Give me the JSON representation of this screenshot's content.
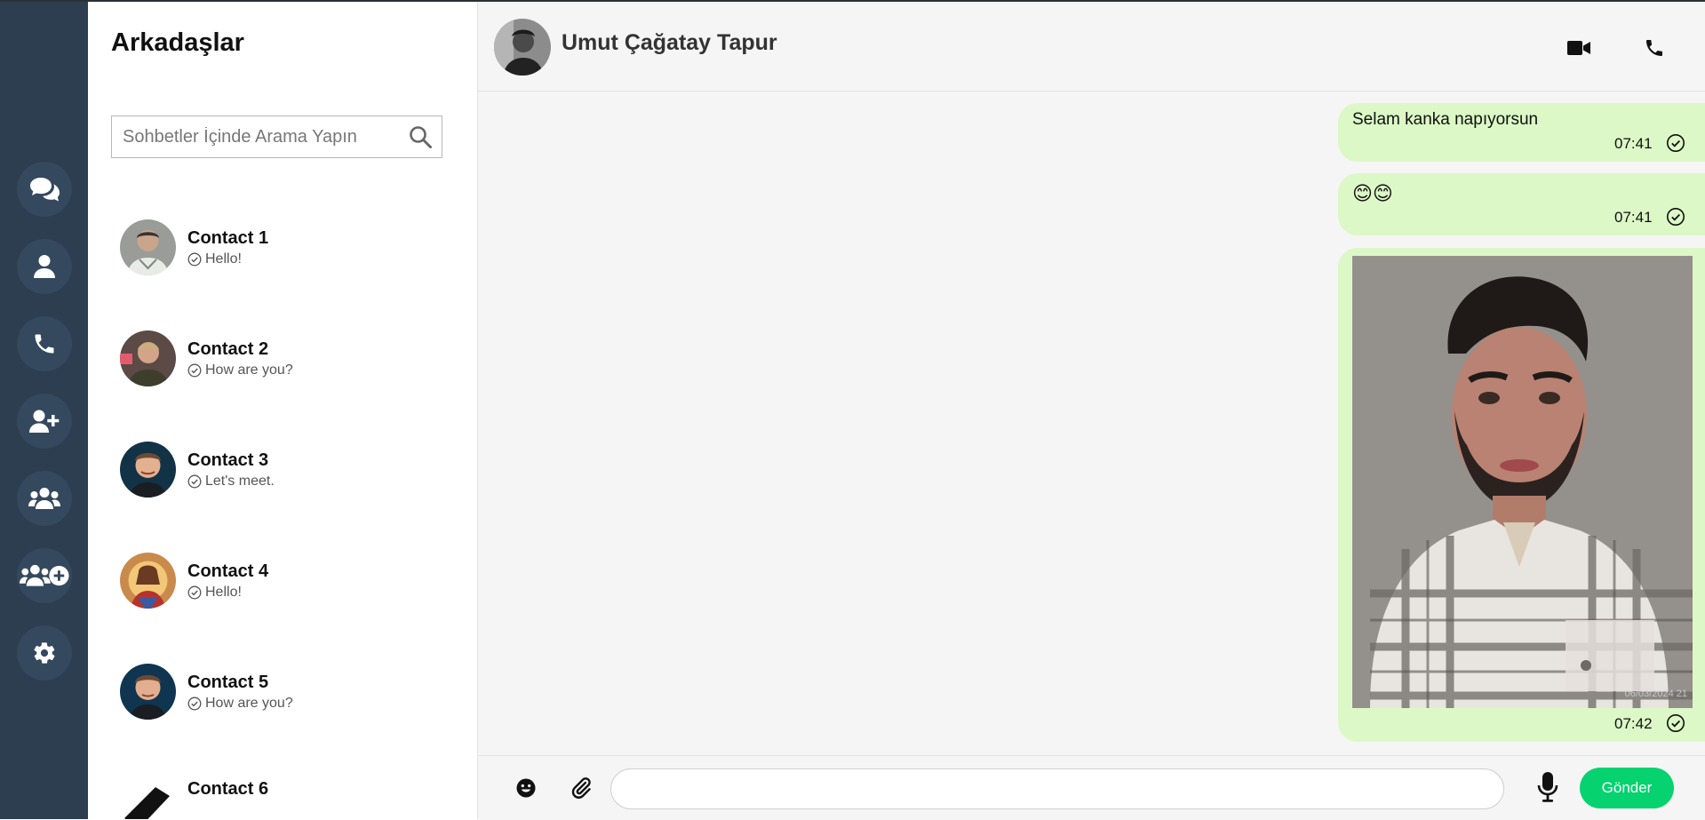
{
  "nav": {
    "icons": [
      "chats-icon",
      "profile-icon",
      "calls-icon",
      "add-friend-icon",
      "groups-icon",
      "add-group-icon",
      "settings-icon"
    ]
  },
  "sidebar": {
    "title": "Arkadaşlar",
    "search_placeholder": "Sohbetler İçinde Arama Yapın",
    "contacts": [
      {
        "name": "Contact 1",
        "last_message": "Hello!"
      },
      {
        "name": "Contact 2",
        "last_message": "How are you?"
      },
      {
        "name": "Contact 3",
        "last_message": "Let's meet."
      },
      {
        "name": "Contact 4",
        "last_message": "Hello!"
      },
      {
        "name": "Contact 5",
        "last_message": "How are you?"
      },
      {
        "name": "Contact 6",
        "last_message": ""
      }
    ]
  },
  "chat": {
    "contact_name": "Umut Çağatay Tapur",
    "header_icons": [
      "video-call-icon",
      "phone-icon"
    ],
    "messages": [
      {
        "type": "text",
        "text": "Selam kanka napıyorsun",
        "time": "07:41",
        "status": "sent"
      },
      {
        "type": "emoji",
        "text": "😊😊",
        "time": "07:41",
        "status": "sent"
      },
      {
        "type": "image",
        "image_caption": "06/03/2024 21",
        "time": "07:42",
        "status": "sent"
      }
    ]
  },
  "composer": {
    "input_value": "",
    "send_label": "Gönder",
    "icons": [
      "emoji-icon",
      "attach-icon",
      "microphone-icon"
    ]
  },
  "colors": {
    "rail": "#2c3e50",
    "rail_button": "#34495e",
    "bubble": "#dcf8c6",
    "send": "#06d26f",
    "chat_bg": "#f5f5f5"
  }
}
